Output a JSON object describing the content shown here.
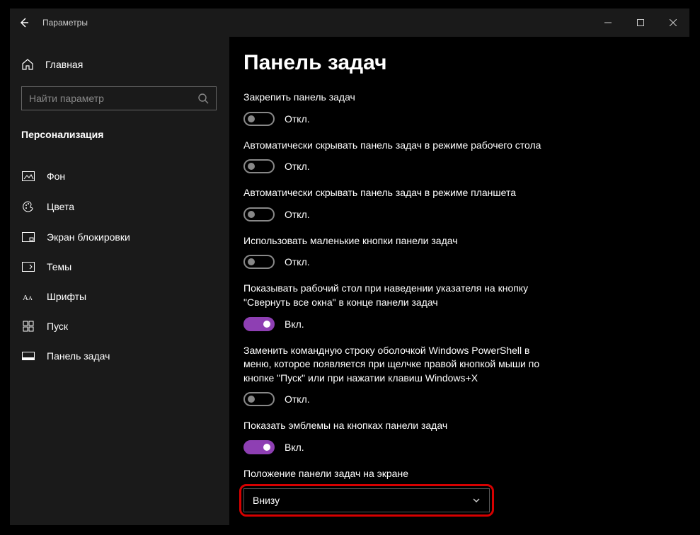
{
  "window": {
    "title": "Параметры"
  },
  "sidebar": {
    "home": "Главная",
    "search_placeholder": "Найти параметр",
    "category": "Персонализация",
    "items": [
      {
        "label": "Фон"
      },
      {
        "label": "Цвета"
      },
      {
        "label": "Экран блокировки"
      },
      {
        "label": "Темы"
      },
      {
        "label": "Шрифты"
      },
      {
        "label": "Пуск"
      },
      {
        "label": "Панель задач"
      }
    ]
  },
  "main": {
    "title": "Панель задач",
    "state_on": "Вкл.",
    "state_off": "Откл.",
    "settings": [
      {
        "label": "Закрепить панель задач",
        "on": false
      },
      {
        "label": "Автоматически скрывать панель задач в режиме рабочего стола",
        "on": false
      },
      {
        "label": "Автоматически скрывать панель задач в режиме планшета",
        "on": false
      },
      {
        "label": "Использовать маленькие кнопки панели задач",
        "on": false
      },
      {
        "label": "Показывать рабочий стол при наведении указателя на кнопку \"Свернуть все окна\" в конце панели задач",
        "on": true
      },
      {
        "label": "Заменить командную строку оболочкой Windows PowerShell в меню, которое появляется при щелчке правой кнопкой мыши по кнопке \"Пуск\" или при нажатии клавиш Windows+X",
        "on": false
      },
      {
        "label": "Показать эмблемы на кнопках панели задач",
        "on": true
      }
    ],
    "position_label": "Положение панели задач на экране",
    "position_value": "Внизу"
  }
}
